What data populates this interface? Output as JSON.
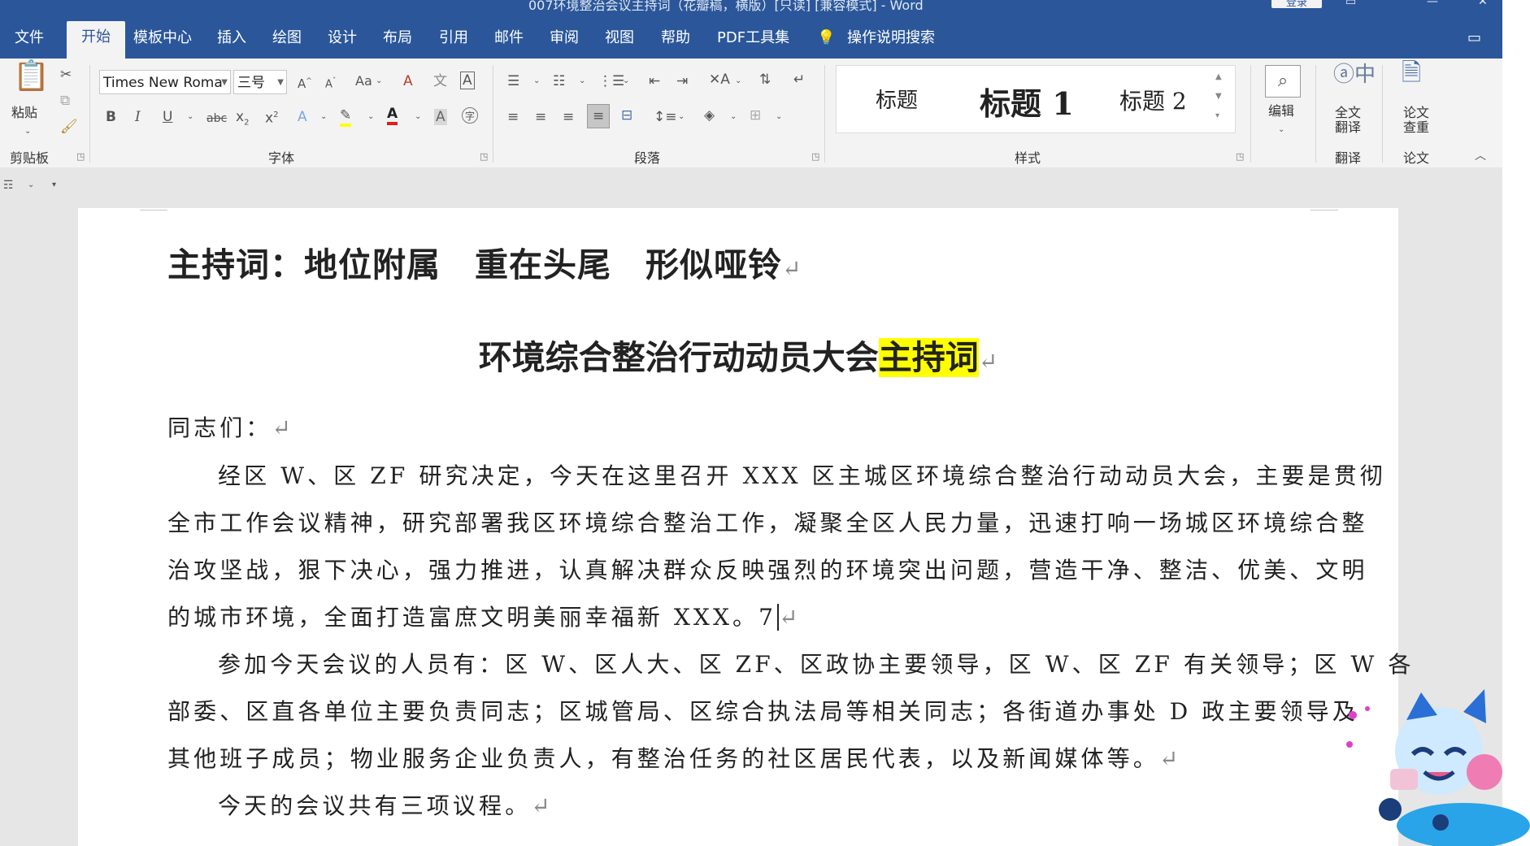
{
  "window": {
    "title": "007环境整治会议主持词（花瓣稿，横版）[只读] [兼容模式] - Word",
    "login_label": "登录"
  },
  "menu": {
    "tabs": [
      "文件",
      "开始",
      "模板中心",
      "插入",
      "绘图",
      "设计",
      "布局",
      "引用",
      "邮件",
      "审阅",
      "视图",
      "帮助",
      "PDF工具集"
    ],
    "search_label": "操作说明搜索"
  },
  "ribbon": {
    "clipboard": {
      "paste_label": "粘贴",
      "group_label": "剪贴板"
    },
    "font": {
      "font_name": "Times New Roma",
      "font_size": "三号",
      "group_label": "字体",
      "change_case": "Aa"
    },
    "paragraph": {
      "group_label": "段落"
    },
    "styles": {
      "items": [
        "标题",
        "标题 1",
        "标题 2"
      ],
      "group_label": "样式"
    },
    "editing": {
      "label": "编辑"
    },
    "translate": {
      "button_line1": "全文",
      "button_line2": "翻译",
      "group_label": "翻译"
    },
    "paper": {
      "button_line1": "论文",
      "button_line2": "查重",
      "group_label": "论文"
    }
  },
  "document": {
    "heading1": "主持词：地位附属　重在头尾　形似哑铃",
    "heading2_main": "环境综合整治行动动员大会",
    "heading2_highlight": "主持词",
    "greeting": "同志们：",
    "p1_lines": [
      "经区 W、区 ZF 研究决定，今天在这里召开 XXX 区主城区环境综合整治行动动员大会，主要是贯彻",
      "全市工作会议精神，研究部署我区环境综合整治工作，凝聚全区人民力量，迅速打响一场城区环境综合整",
      "治攻坚战，狠下决心，强力推进，认真解决群众反映强烈的环境突出问题，营造干净、整洁、优美、文明",
      "的城市环境，全面打造富庶文明美丽幸福新 XXX。7"
    ],
    "p2_lines": [
      "参加今天会议的人员有：区 W、区人大、区 ZF、区政协主要领导，区 W、区 ZF 有关领导；区 W 各",
      "部委、区直各单位主要负责同志；区城管局、区综合执法局等相关同志；各街道办事处 D 政主要领导及",
      "其他班子成员；物业服务企业负责人，有整治任务的社区居民代表，以及新闻媒体等。"
    ],
    "p3": "今天的会议共有三项议程。",
    "para_mark": "↵"
  },
  "colors": {
    "title_bar": "#2b579a",
    "ribbon_bg": "#f3f3f3",
    "highlight": "#ffff00",
    "font_color_red": "#e0201b"
  }
}
